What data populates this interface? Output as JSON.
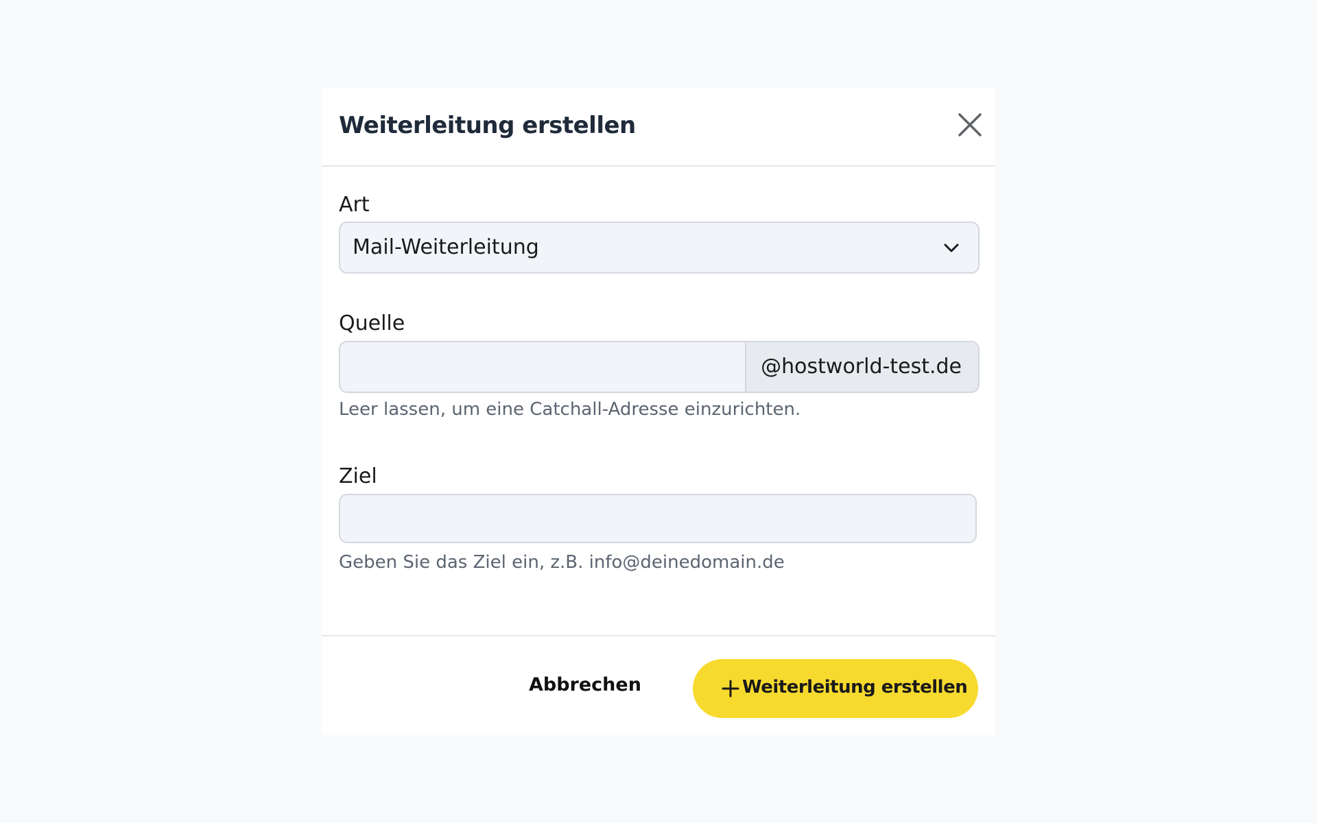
{
  "dialog": {
    "title": "Weiterleitung erstellen",
    "close_icon": "close-icon"
  },
  "form": {
    "type": {
      "label": "Art",
      "selected": "Mail-Weiterleitung",
      "icon": "chevron-down-icon"
    },
    "source": {
      "label": "Quelle",
      "value": "",
      "suffix": "@hostworld-test.de",
      "help": "Leer lassen, um eine Catchall-Adresse einzurichten."
    },
    "target": {
      "label": "Ziel",
      "value": "",
      "help": "Geben Sie das Ziel ein, z.B. info@deinedomain.de"
    }
  },
  "footer": {
    "cancel_label": "Abbrechen",
    "submit_label": "Weiterleitung erstellen",
    "submit_icon": "plus-icon"
  },
  "colors": {
    "background": "#f9fafc",
    "primary": "#f7da2e",
    "input_bg": "#f1f4f8",
    "border": "#d4d8de"
  }
}
